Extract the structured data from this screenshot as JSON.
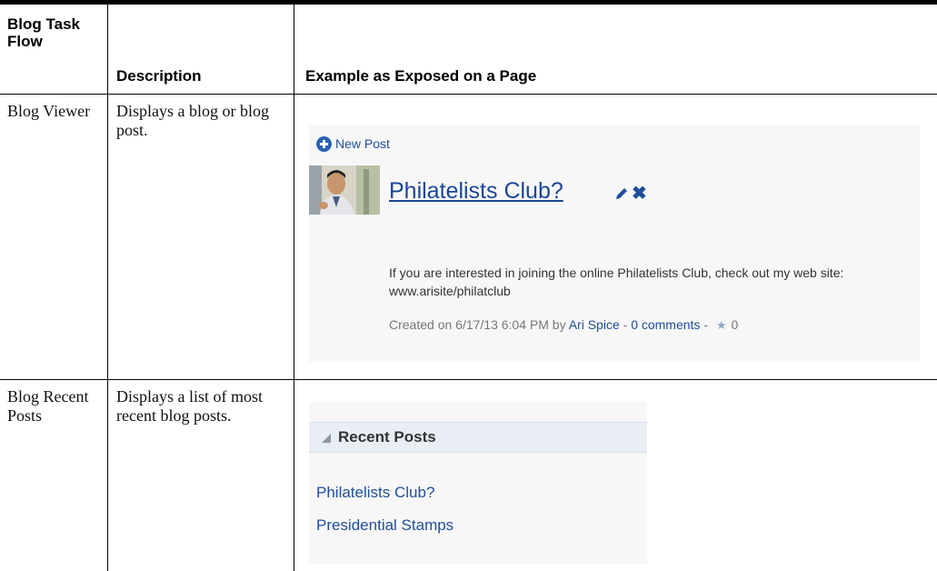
{
  "table": {
    "headers": {
      "task_flow": "Blog Task Flow",
      "description": "Description",
      "example": "Example as Exposed on a Page"
    },
    "rows": [
      {
        "task_flow": "Blog Viewer",
        "description": "Displays a blog or blog post."
      },
      {
        "task_flow": "Blog Recent Posts",
        "description": "Displays a list of most recent blog posts."
      }
    ]
  },
  "blog_viewer": {
    "new_post_label": "New Post",
    "post_title": "Philatelists Club?",
    "post_body": "If you are interested in joining the online Philatelists Club, check out my web site: www.arisite/philatclub",
    "meta_prefix": "Created on 6/17/13 6:04 PM by ",
    "author": "Ari Spice",
    "separator": " - ",
    "comments": "0 comments",
    "separator2": " - ",
    "rating": "0",
    "icons": {
      "new": "plus-circle-icon",
      "edit": "pencil-icon",
      "delete": "close-icon",
      "rating": "star-icon"
    },
    "link_color": "#1f4e99"
  },
  "recent_posts": {
    "title": "Recent Posts",
    "items": [
      "Philatelists Club?",
      "Presidential Stamps"
    ]
  }
}
